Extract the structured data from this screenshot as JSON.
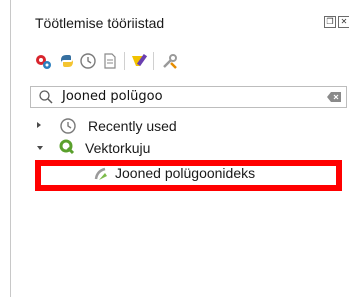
{
  "panel": {
    "title": "Töötlemise tööriistad",
    "float_button": "❐",
    "close_button": "✕"
  },
  "toolbar": {
    "icons": [
      "models-icon",
      "python-icon",
      "history-icon",
      "results-icon",
      "edit-features-icon",
      "options-icon"
    ]
  },
  "search": {
    "value": "Jooned polügoo"
  },
  "tree": {
    "recently_used": "Recently used",
    "vector_geometry": "Vektorkuju",
    "algorithm": "Jooned polügoonideks"
  },
  "colors": {
    "highlight": "#ff0000",
    "qgis_green": "#5aa02c"
  }
}
